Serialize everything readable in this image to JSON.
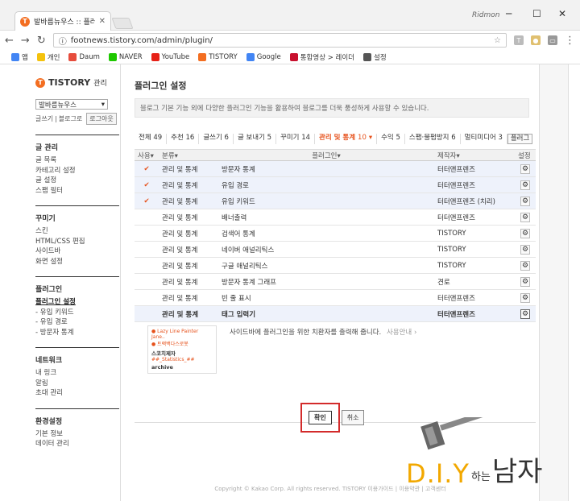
{
  "browser": {
    "tab_title": "발바름뉴우스 :: 플러그인",
    "tab_icon_letter": "T",
    "user": "Ridmon",
    "url": "footnews.tistory.com/admin/plugin/",
    "bookmarks": [
      {
        "label": "앱",
        "color": "#4285f4"
      },
      {
        "label": "개인",
        "color": "#f4c20d"
      },
      {
        "label": "Daum",
        "color": "#e64c3c"
      },
      {
        "label": "NAVER",
        "color": "#1ec800"
      },
      {
        "label": "YouTube",
        "color": "#e62117"
      },
      {
        "label": "TISTORY",
        "color": "#f36e21"
      },
      {
        "label": "Google",
        "color": "#4285f4"
      },
      {
        "label": "통합영상 > 레이더",
        "color": "#c8102e"
      },
      {
        "label": "설정",
        "color": "#555555"
      }
    ]
  },
  "sidebar": {
    "logo": "TISTORY",
    "logo_sub": "관리",
    "blog_select": "발바름뉴우스",
    "quick_write": "글쓰기",
    "quick_divider": "|",
    "quick_blog": "블로그로",
    "logout": "로그아웃",
    "sections": [
      {
        "title": "글 관리",
        "items": [
          "글 목록",
          "카테고리 설정",
          "글 설정",
          "스팸 필터"
        ]
      },
      {
        "title": "꾸미기",
        "items": [
          "스킨",
          "HTML/CSS 편집",
          "사이드바",
          "화면 설정"
        ]
      },
      {
        "title": "플러그인",
        "items": [
          "플러그인 설정",
          "- 유입 키워드",
          "- 유입 경로",
          "- 방문자 통계"
        ]
      },
      {
        "title": "네트워크",
        "items": [
          "내 링크",
          "알림",
          "초대 관리"
        ]
      },
      {
        "title": "환경설정",
        "items": [
          "기본 정보",
          "데이터 관리"
        ]
      }
    ]
  },
  "main": {
    "title": "플러그인 설정",
    "description": "블로그 기본 기능 외에 다양한 플러그인 기능을 활용하여 블로그를 더욱 풍성하게 사용할 수 있습니다.",
    "categories": [
      {
        "label": "전체",
        "count": "49"
      },
      {
        "label": "추천",
        "count": "16"
      },
      {
        "label": "글쓰기",
        "count": "6"
      },
      {
        "label": "글 보내기",
        "count": "5"
      },
      {
        "label": "꾸미기",
        "count": "14"
      },
      {
        "label": "관리 및 통계",
        "count": "10"
      },
      {
        "label": "수익",
        "count": "5"
      },
      {
        "label": "스팸·불펌방지",
        "count": "6"
      },
      {
        "label": "멀티미디어",
        "count": "3"
      }
    ],
    "category_more": "플러그",
    "table": {
      "headers": {
        "use": "사용",
        "type": "분류",
        "plugin": "플러그인",
        "maker": "제작자",
        "settings": "설정"
      },
      "rows": [
        {
          "used": true,
          "type": "관리 및 통계",
          "name": "방문자 통계",
          "maker": "터터앤프렌즈"
        },
        {
          "used": true,
          "type": "관리 및 통계",
          "name": "유입 경로",
          "maker": "터터앤프렌즈"
        },
        {
          "used": true,
          "type": "관리 및 통계",
          "name": "유입 키워드",
          "maker": "터터앤프렌즈 (치리)"
        },
        {
          "used": false,
          "type": "관리 및 통계",
          "name": "배너출력",
          "maker": "터터앤프렌즈"
        },
        {
          "used": false,
          "type": "관리 및 통계",
          "name": "검색어 통계",
          "maker": "TISTORY"
        },
        {
          "used": false,
          "type": "관리 및 통계",
          "name": "네이버 애널리틱스",
          "maker": "TISTORY"
        },
        {
          "used": false,
          "type": "관리 및 통계",
          "name": "구글 애널리틱스",
          "maker": "TISTORY"
        },
        {
          "used": false,
          "type": "관리 및 통계",
          "name": "방문자 통계 그래프",
          "maker": "견로"
        },
        {
          "used": false,
          "type": "관리 및 통계",
          "name": "빈 줄 표시",
          "maker": "터터앤프렌즈"
        },
        {
          "used": false,
          "type": "관리 및 통계",
          "name": "태그 입력기",
          "maker": "터터앤프렌즈",
          "selected": true
        }
      ]
    },
    "detail": {
      "thumb_lines": [
        "● Lazy Line Painter Jane..",
        "● 트랙백다스로봇",
        "스코치제자",
        "##_Statistics_##",
        "archive"
      ],
      "description": "사이드바에 플러그인을 위한 치환자를 출력해 줍니다.",
      "link": "사용안내 ›"
    },
    "confirm": "확인",
    "cancel": "취소"
  },
  "footer": "Copyright © Kakao Corp. All rights reserved. TISTORY 이용가이드 | 이용약관 | 고객센터",
  "watermark": {
    "diy": "D.I.Y",
    "mid": "하는",
    "man": "남자"
  }
}
